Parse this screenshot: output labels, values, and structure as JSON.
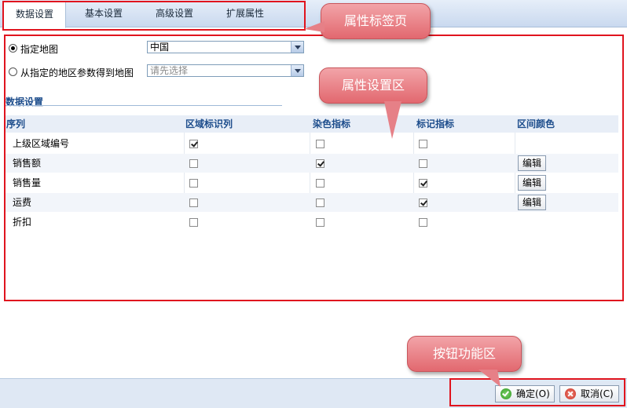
{
  "tabs": [
    {
      "label": "数据设置",
      "active": true
    },
    {
      "label": "基本设置",
      "active": false
    },
    {
      "label": "高级设置",
      "active": false
    },
    {
      "label": "扩展属性",
      "active": false
    }
  ],
  "callouts": {
    "tabs": "属性标签页",
    "settings": "属性设置区",
    "buttons": "按钮功能区"
  },
  "map_options": {
    "specify_map_label": "指定地图",
    "specify_map_selected": true,
    "specify_map_value": "中国",
    "from_param_label": "从指定的地区参数得到地图",
    "from_param_selected": false,
    "from_param_placeholder": "请先选择"
  },
  "data_section": {
    "title": "数据设置",
    "columns": [
      "序列",
      "区域标识列",
      "染色指标",
      "标记指标",
      "区间颜色"
    ],
    "edit_label": "编辑",
    "rows": [
      {
        "name": "上级区域编号",
        "region_id": true,
        "color_index": false,
        "mark_index": false,
        "has_edit": false
      },
      {
        "name": "销售额",
        "region_id": false,
        "color_index": true,
        "mark_index": false,
        "has_edit": true
      },
      {
        "name": "销售量",
        "region_id": false,
        "color_index": false,
        "mark_index": true,
        "has_edit": true
      },
      {
        "name": "运费",
        "region_id": false,
        "color_index": false,
        "mark_index": true,
        "has_edit": true
      },
      {
        "name": "折扣",
        "region_id": false,
        "color_index": false,
        "mark_index": false,
        "has_edit": false
      }
    ]
  },
  "buttons": {
    "ok": "确定(O)",
    "cancel": "取消(C)"
  },
  "colors": {
    "annotation_red": "#e0141e",
    "header_blue": "#1d4d8c",
    "callout_pink": "#e2686f"
  }
}
